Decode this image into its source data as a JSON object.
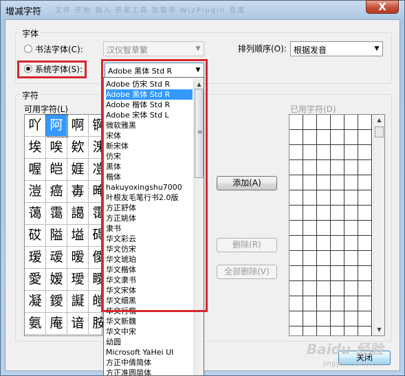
{
  "window": {
    "title": "增减字符",
    "tabs_blurred": "文件   开始   插入   开发工具   加载项   WizPlugin   百度",
    "close_label": "X"
  },
  "font_group": {
    "label": "字体",
    "calligraphy_radio": "书法字体(C):",
    "calligraphy_value": "汉仪智草繁",
    "system_radio": "系统字体(S):",
    "system_value": "Adobe 黑体 Std R",
    "sort_label": "排列顺序(O):",
    "sort_value": "根据发音"
  },
  "chars_group": {
    "label": "字符",
    "available_label": "可用字符(L)",
    "used_label": "已用字符(D)",
    "grid_rows": [
      [
        "吖",
        "阿",
        "啊",
        "锕"
      ],
      [
        "埃",
        "唉",
        "欸",
        "溾"
      ],
      [
        "喔",
        "皑",
        "娾",
        "凒"
      ],
      [
        "溰",
        "癌",
        "毐",
        "晻"
      ],
      [
        "蔼",
        "霭",
        "譪",
        "霭"
      ],
      [
        "砹",
        "隘",
        "塧",
        "碍"
      ],
      [
        "瑷",
        "叆",
        "暧",
        "僾"
      ],
      [
        "愛",
        "嫒",
        "璦",
        "瞹"
      ],
      [
        "凝",
        "鑀",
        "譺",
        "皚"
      ],
      [
        "氨",
        "庵",
        "谙",
        "胺"
      ]
    ]
  },
  "buttons": {
    "add": "添加(A)",
    "delete": "删除(R)",
    "delete_all": "全部删除(V)",
    "close": "关闭"
  },
  "font_list": [
    "Adobe 仿宋 Std R",
    "Adobe 黑体 Std R",
    "Adobe 楷体 Std R",
    "Adobe 宋体 Std L",
    "微软雅黑",
    "宋体",
    "新宋体",
    "仿宋",
    "黑体",
    "楷体",
    "hakuyoxingshu7000",
    "叶根友毛笔行书2.0版",
    "方正舒体",
    "方正姚体",
    "隶书",
    "华文彩云",
    "华文仿宋",
    "华文琥珀",
    "华文楷体",
    "华文隶书",
    "华文宋体",
    "华文细黑",
    "华文行楷",
    "华文新魏",
    "华文中宋",
    "幼圆",
    "Microsoft YaHei UI",
    "方正中倩简体",
    "方正准圆简体"
  ],
  "font_list_selected_index": 1,
  "watermark": {
    "text": "Baidu 经验",
    "sub": "jingyan.baidu.com"
  },
  "colors": {
    "highlight": "#3399ff",
    "annotation_red": "#d8262c",
    "title_close": "#c4503a"
  }
}
